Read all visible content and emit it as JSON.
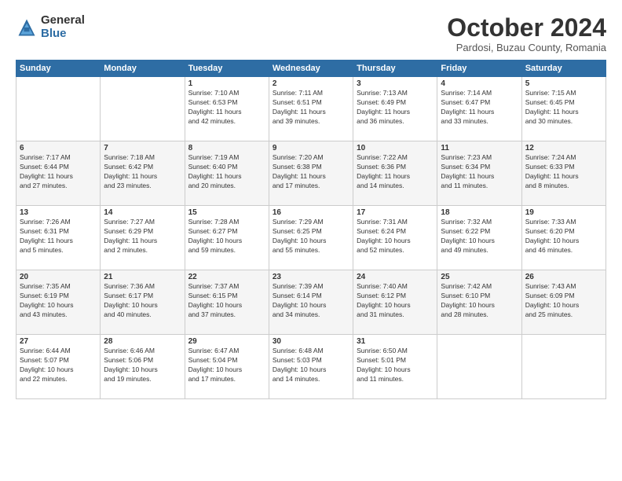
{
  "logo": {
    "general": "General",
    "blue": "Blue"
  },
  "header": {
    "month": "October 2024",
    "location": "Pardosi, Buzau County, Romania"
  },
  "weekdays": [
    "Sunday",
    "Monday",
    "Tuesday",
    "Wednesday",
    "Thursday",
    "Friday",
    "Saturday"
  ],
  "weeks": [
    [
      {
        "day": "",
        "info": ""
      },
      {
        "day": "",
        "info": ""
      },
      {
        "day": "1",
        "info": "Sunrise: 7:10 AM\nSunset: 6:53 PM\nDaylight: 11 hours\nand 42 minutes."
      },
      {
        "day": "2",
        "info": "Sunrise: 7:11 AM\nSunset: 6:51 PM\nDaylight: 11 hours\nand 39 minutes."
      },
      {
        "day": "3",
        "info": "Sunrise: 7:13 AM\nSunset: 6:49 PM\nDaylight: 11 hours\nand 36 minutes."
      },
      {
        "day": "4",
        "info": "Sunrise: 7:14 AM\nSunset: 6:47 PM\nDaylight: 11 hours\nand 33 minutes."
      },
      {
        "day": "5",
        "info": "Sunrise: 7:15 AM\nSunset: 6:45 PM\nDaylight: 11 hours\nand 30 minutes."
      }
    ],
    [
      {
        "day": "6",
        "info": "Sunrise: 7:17 AM\nSunset: 6:44 PM\nDaylight: 11 hours\nand 27 minutes."
      },
      {
        "day": "7",
        "info": "Sunrise: 7:18 AM\nSunset: 6:42 PM\nDaylight: 11 hours\nand 23 minutes."
      },
      {
        "day": "8",
        "info": "Sunrise: 7:19 AM\nSunset: 6:40 PM\nDaylight: 11 hours\nand 20 minutes."
      },
      {
        "day": "9",
        "info": "Sunrise: 7:20 AM\nSunset: 6:38 PM\nDaylight: 11 hours\nand 17 minutes."
      },
      {
        "day": "10",
        "info": "Sunrise: 7:22 AM\nSunset: 6:36 PM\nDaylight: 11 hours\nand 14 minutes."
      },
      {
        "day": "11",
        "info": "Sunrise: 7:23 AM\nSunset: 6:34 PM\nDaylight: 11 hours\nand 11 minutes."
      },
      {
        "day": "12",
        "info": "Sunrise: 7:24 AM\nSunset: 6:33 PM\nDaylight: 11 hours\nand 8 minutes."
      }
    ],
    [
      {
        "day": "13",
        "info": "Sunrise: 7:26 AM\nSunset: 6:31 PM\nDaylight: 11 hours\nand 5 minutes."
      },
      {
        "day": "14",
        "info": "Sunrise: 7:27 AM\nSunset: 6:29 PM\nDaylight: 11 hours\nand 2 minutes."
      },
      {
        "day": "15",
        "info": "Sunrise: 7:28 AM\nSunset: 6:27 PM\nDaylight: 10 hours\nand 59 minutes."
      },
      {
        "day": "16",
        "info": "Sunrise: 7:29 AM\nSunset: 6:25 PM\nDaylight: 10 hours\nand 55 minutes."
      },
      {
        "day": "17",
        "info": "Sunrise: 7:31 AM\nSunset: 6:24 PM\nDaylight: 10 hours\nand 52 minutes."
      },
      {
        "day": "18",
        "info": "Sunrise: 7:32 AM\nSunset: 6:22 PM\nDaylight: 10 hours\nand 49 minutes."
      },
      {
        "day": "19",
        "info": "Sunrise: 7:33 AM\nSunset: 6:20 PM\nDaylight: 10 hours\nand 46 minutes."
      }
    ],
    [
      {
        "day": "20",
        "info": "Sunrise: 7:35 AM\nSunset: 6:19 PM\nDaylight: 10 hours\nand 43 minutes."
      },
      {
        "day": "21",
        "info": "Sunrise: 7:36 AM\nSunset: 6:17 PM\nDaylight: 10 hours\nand 40 minutes."
      },
      {
        "day": "22",
        "info": "Sunrise: 7:37 AM\nSunset: 6:15 PM\nDaylight: 10 hours\nand 37 minutes."
      },
      {
        "day": "23",
        "info": "Sunrise: 7:39 AM\nSunset: 6:14 PM\nDaylight: 10 hours\nand 34 minutes."
      },
      {
        "day": "24",
        "info": "Sunrise: 7:40 AM\nSunset: 6:12 PM\nDaylight: 10 hours\nand 31 minutes."
      },
      {
        "day": "25",
        "info": "Sunrise: 7:42 AM\nSunset: 6:10 PM\nDaylight: 10 hours\nand 28 minutes."
      },
      {
        "day": "26",
        "info": "Sunrise: 7:43 AM\nSunset: 6:09 PM\nDaylight: 10 hours\nand 25 minutes."
      }
    ],
    [
      {
        "day": "27",
        "info": "Sunrise: 6:44 AM\nSunset: 5:07 PM\nDaylight: 10 hours\nand 22 minutes."
      },
      {
        "day": "28",
        "info": "Sunrise: 6:46 AM\nSunset: 5:06 PM\nDaylight: 10 hours\nand 19 minutes."
      },
      {
        "day": "29",
        "info": "Sunrise: 6:47 AM\nSunset: 5:04 PM\nDaylight: 10 hours\nand 17 minutes."
      },
      {
        "day": "30",
        "info": "Sunrise: 6:48 AM\nSunset: 5:03 PM\nDaylight: 10 hours\nand 14 minutes."
      },
      {
        "day": "31",
        "info": "Sunrise: 6:50 AM\nSunset: 5:01 PM\nDaylight: 10 hours\nand 11 minutes."
      },
      {
        "day": "",
        "info": ""
      },
      {
        "day": "",
        "info": ""
      }
    ]
  ]
}
